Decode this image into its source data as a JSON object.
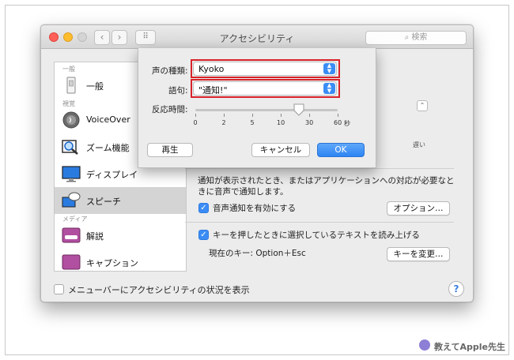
{
  "window": {
    "title": "アクセシビリティ",
    "search_placeholder": "検索"
  },
  "sidebar": {
    "sections": [
      "一般",
      "視覚",
      "メディア"
    ],
    "items": [
      {
        "label": "一般",
        "icon": "switch-icon"
      },
      {
        "label": "VoiceOver",
        "icon": "voiceover-icon"
      },
      {
        "label": "ズーム機能",
        "icon": "zoom-icon"
      },
      {
        "label": "ディスプレイ",
        "icon": "display-icon"
      },
      {
        "label": "スピーチ",
        "icon": "speech-icon",
        "selected": true
      },
      {
        "label": "解説",
        "icon": "descriptions-icon"
      },
      {
        "label": "キャプション",
        "icon": "captions-icon"
      }
    ]
  },
  "content": {
    "notify_text": "通知が表示されたとき、またはアプリケーションへの対応が必要なときに音声で通知します。",
    "announce_checkbox": "音声通知を有効にする",
    "options_button": "オプション…",
    "speak_selected_checkbox": "キーを押したときに選択しているテキストを読み上げる",
    "current_key": "現在のキー: Option＋Esc",
    "change_key_button": "キーを変更…",
    "partial_text": "遅い"
  },
  "bottom": {
    "menubar_checkbox": "メニューバーにアクセシビリティの状況を表示",
    "help": "?"
  },
  "sheet": {
    "voice_label": "声の種類:",
    "voice_value": "Kyoko",
    "phrase_label": "語句:",
    "phrase_value": "\"通知!\"",
    "delay_label": "反応時間:",
    "delay_ticks": [
      "0",
      "2",
      "5",
      "10",
      "30",
      "60"
    ],
    "delay_unit": "秒",
    "delay_value_fraction": 0.73,
    "play_button": "再生",
    "cancel_button": "キャンセル",
    "ok_button": "OK"
  },
  "watermark": "教えてApple先生",
  "colors": {
    "accent": "#3b8df5",
    "highlight": "#d8232a"
  }
}
